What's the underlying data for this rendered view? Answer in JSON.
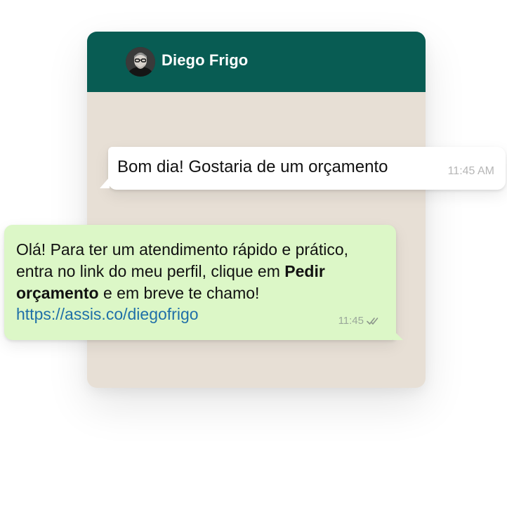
{
  "header": {
    "contact_name": "Diego Frigo",
    "avatar_icon": "profile-photo",
    "background": "#085c53"
  },
  "chat": {
    "background": "#e7dfd5",
    "messages": [
      {
        "direction": "incoming",
        "text": "Bom dia! Gostaria de um orçamento",
        "time": "11:45 AM"
      },
      {
        "direction": "outgoing",
        "text_parts": [
          "Olá! Para ter um atendimento rápido e prático, entra no link do meu perfil, clique em ",
          "Pedir orçamento",
          " e em breve te chamo!"
        ],
        "link": "https://assis.co/diegofrigo",
        "time": "11:45",
        "status_icon": "double-check-icon",
        "bubble_color": "#dcf7c7",
        "link_color": "#1f6fa8"
      }
    ]
  }
}
